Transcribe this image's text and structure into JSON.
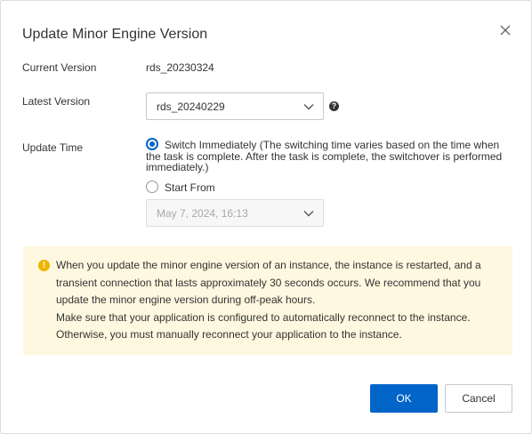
{
  "dialog": {
    "title": "Update Minor Engine Version"
  },
  "fields": {
    "current_version_label": "Current Version",
    "current_version_value": "rds_20230324",
    "latest_version_label": "Latest Version",
    "latest_version_value": "rds_20240229",
    "update_time_label": "Update Time"
  },
  "update_time": {
    "selected": "switch_immediately",
    "switch_immediately_line1": "Switch Immediately (The switching time varies based on the time when",
    "switch_immediately_line2": "the task is complete. After the task is complete, the switchover is performed",
    "switch_immediately_line3": "immediately.)",
    "start_from_label": "Start From",
    "start_from_value": "May 7, 2024, 16:13"
  },
  "notice": {
    "line1": "When you update the minor engine version of an instance, the instance is restarted, and a",
    "line2": "transient connection that lasts approximately 30 seconds occurs. We recommend that you",
    "line3": "update the minor engine version during off-peak hours.",
    "line4": "Make sure that your application is configured to automatically reconnect to the instance.",
    "line5": "Otherwise, you must manually reconnect your application to the instance."
  },
  "buttons": {
    "ok_label": "OK",
    "cancel_label": "Cancel"
  },
  "icons": {
    "close": "close-icon",
    "help": "help-icon",
    "chevron": "chevron-down-icon",
    "warning": "warning-icon"
  },
  "colors": {
    "primary": "#0064c8",
    "notice_background": "#fff8e0",
    "warning": "#f0b400"
  }
}
